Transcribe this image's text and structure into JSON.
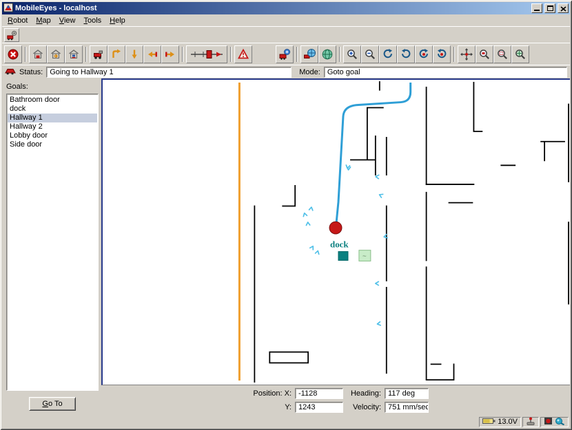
{
  "window": {
    "title": "MobileEyes - localhost"
  },
  "menu_bar": {
    "items": [
      "Robot",
      "Map",
      "View",
      "Tools",
      "Help"
    ]
  },
  "toolbar_top": [
    [
      "robot-setup"
    ]
  ],
  "toolbar_main_left": [
    [
      "stop"
    ],
    [
      "dock",
      "dock-retrieve",
      "dock-station"
    ],
    [
      "drive-robot",
      "turn-upleft",
      "turn-down",
      "turn-left",
      "turn-right"
    ],
    [
      "speed-slider"
    ],
    [
      "alarm"
    ]
  ],
  "toolbar_main_right": [
    [
      "remote-camera"
    ],
    [
      "robot-globe",
      "globe"
    ],
    [
      "zoom-in",
      "zoom-out",
      "rotate-cw",
      "rotate-ccw",
      "orbit-cw",
      "orbit-ccw"
    ],
    [
      "center-on-robot",
      "zoom-to-robot",
      "zoom-to-region",
      "zoom-to-fit"
    ]
  ],
  "status_row": {
    "status_label": "Status:",
    "status_value": "Going to Hallway 1",
    "mode_label": "Mode:",
    "mode_value": "Goto goal"
  },
  "goals_panel": {
    "label": "Goals:",
    "items": [
      "Bathroom door",
      "dock",
      "Hallway 1",
      "Hallway 2",
      "Lobby door",
      "Side door"
    ],
    "selected": "Hallway 1",
    "goto_button": "Go To"
  },
  "map": {
    "dock_label": "dock",
    "dock_marker_glyph": "~"
  },
  "telemetry": {
    "position_x_label": "Position: X:",
    "position_x_value": "-1128",
    "y_label": "Y:",
    "y_value": "1243",
    "heading_label": "Heading:",
    "heading_value": "117 deg",
    "velocity_label": "Velocity:",
    "velocity_value": "751 mm/sec"
  },
  "tray": {
    "battery_voltage": "13.0V"
  },
  "colors": {
    "titlebar_left": "#0a246a",
    "titlebar_right": "#a6caf0",
    "chrome": "#d4d0c8",
    "map_path_blue": "#2f9fd6",
    "robot_red": "#c61818",
    "dock_teal": "#0b8080",
    "sensor_cyan": "#50c0e8",
    "boundary_orange": "#ef9f2f"
  }
}
